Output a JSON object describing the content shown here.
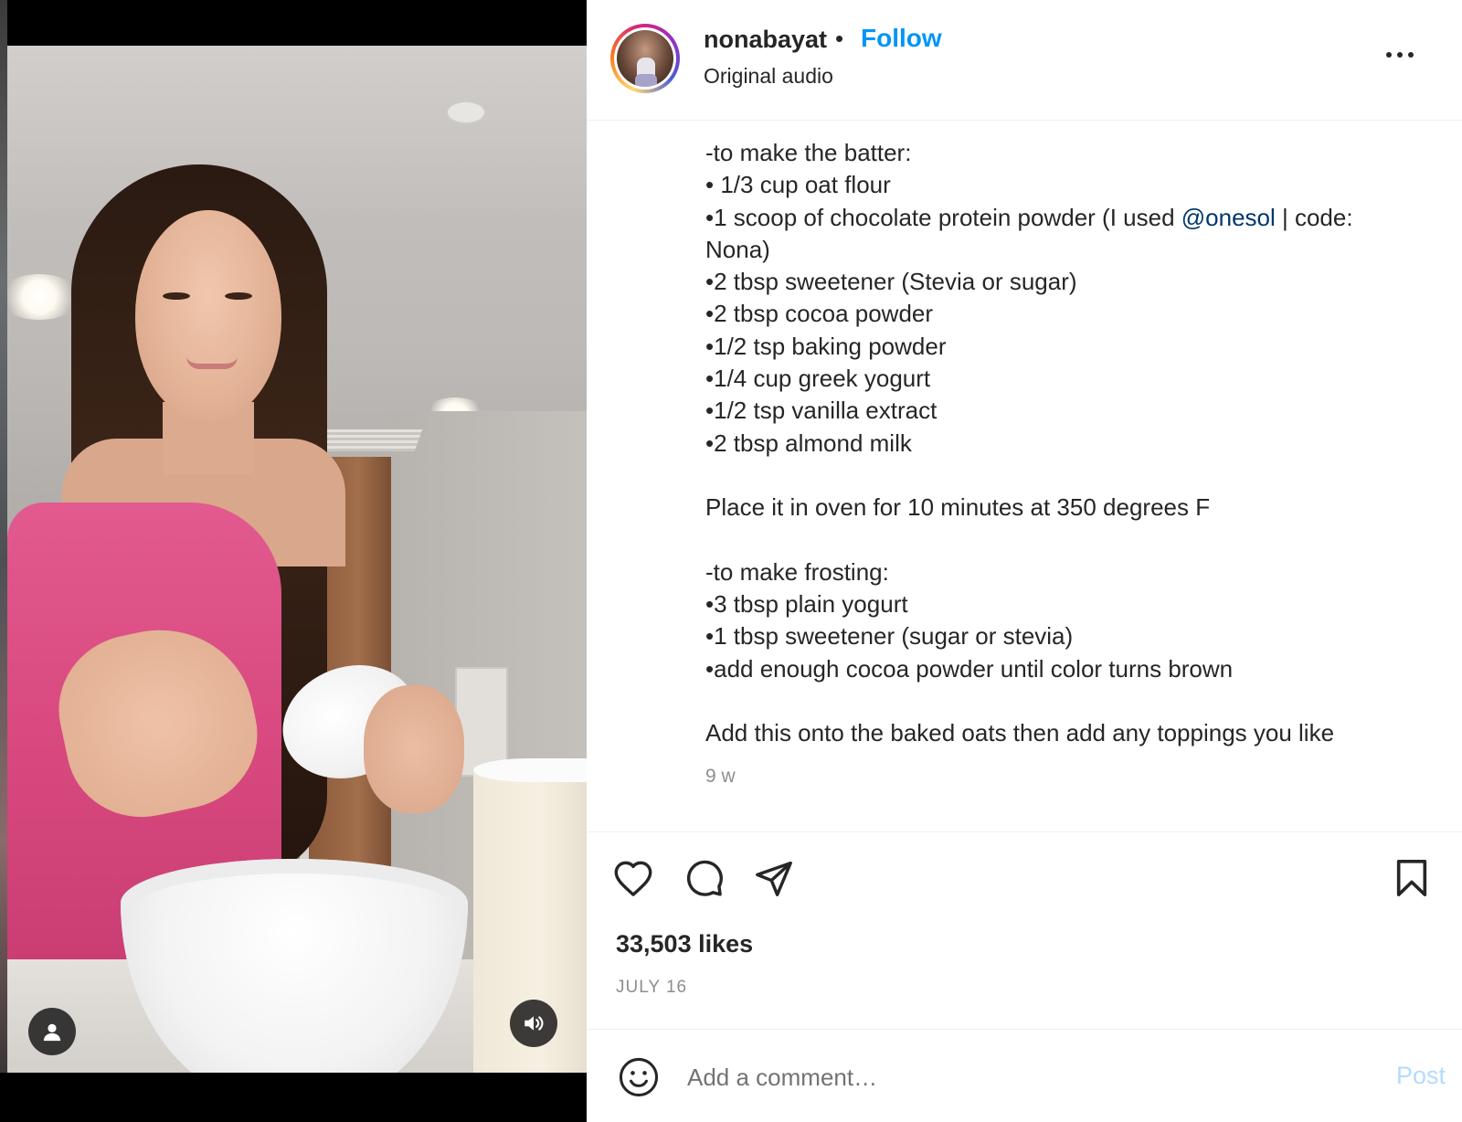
{
  "post": {
    "username": "nonabayat",
    "separator": "•",
    "follow_label": "Follow",
    "audio_label": "Original audio",
    "more_icon": "more-horizontal-icon"
  },
  "caption": {
    "lines": [
      "-to make the batter:",
      "• 1/3 cup oat flour",
      "•1 scoop of chocolate protein powder (I used ",
      "Nona)",
      "•2 tbsp sweetener (Stevia or sugar)",
      "•2 tbsp cocoa powder",
      "•1/2 tsp baking powder",
      "•1/4 cup greek yogurt",
      "•1/2 tsp vanilla extract",
      "•2 tbsp almond milk",
      "",
      "Place it in oven for 10 minutes at 350 degrees F",
      "",
      "-to make frosting:",
      "•3 tbsp plain yogurt",
      "•1 tbsp sweetener (sugar or stevia)",
      "•add enough cocoa powder until color turns brown",
      "",
      "Add this onto the baked oats then add any toppings you like"
    ],
    "mention": "@onesol",
    "mention_suffix": " | code:",
    "time_ago": "9 w"
  },
  "actions": {
    "like_icon": "heart-icon",
    "comment_icon": "comment-icon",
    "share_icon": "share-icon",
    "save_icon": "bookmark-icon"
  },
  "likes": "33,503 likes",
  "date": "JULY 16",
  "comment": {
    "placeholder": "Add a comment…",
    "post_label": "Post"
  },
  "colors": {
    "accent": "#0095f6",
    "mention": "#00376b",
    "post_disabled": "#b3dbff",
    "muted": "#8e8e8e"
  }
}
